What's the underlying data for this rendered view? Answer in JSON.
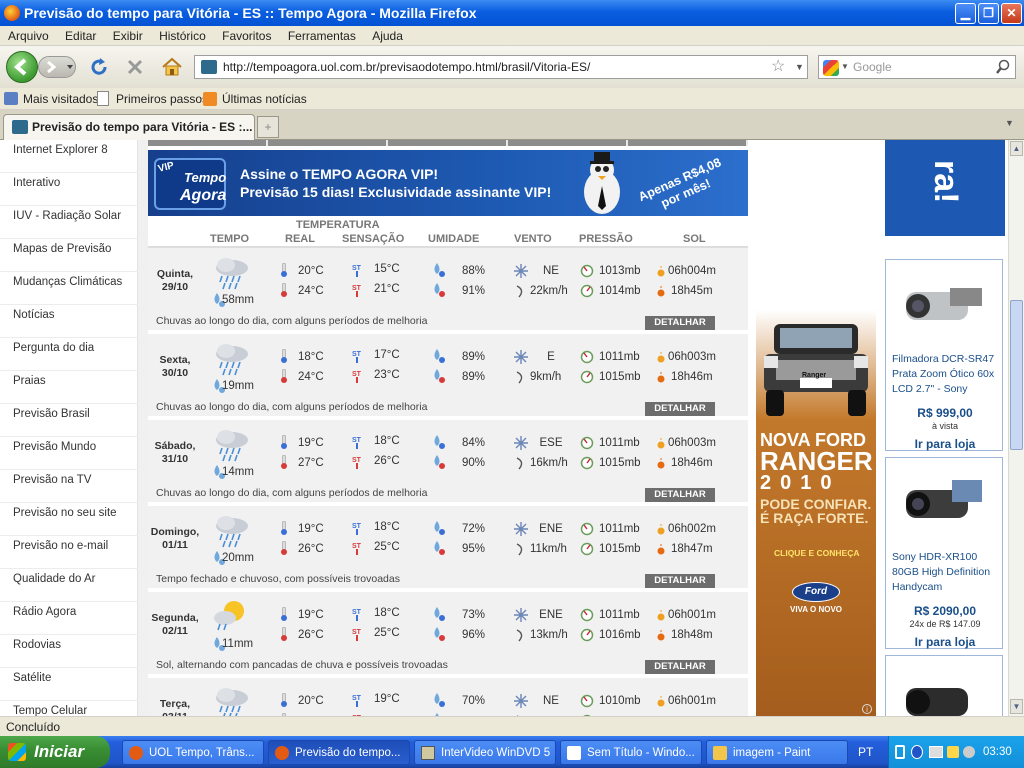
{
  "window": {
    "title": "Previsão do tempo para Vitória - ES :: Tempo Agora - Mozilla Firefox"
  },
  "menu": [
    "Arquivo",
    "Editar",
    "Exibir",
    "Histórico",
    "Favoritos",
    "Ferramentas",
    "Ajuda"
  ],
  "nav": {
    "url": "http://tempoagora.uol.com.br/previsaodotempo.html/brasil/Vitoria-ES/",
    "search_placeholder": "Google"
  },
  "bookmarks": [
    "Mais visitados",
    "Primeiros passos",
    "Últimas notícias"
  ],
  "tab": {
    "title": "Previsão do tempo para Vitória - ES :..."
  },
  "sidebar": [
    "Internet Explorer 8",
    "Interativo",
    "IUV - Radiação Solar",
    "Mapas de Previsão",
    "Mudanças Climáticas",
    "Notícias",
    "Pergunta do dia",
    "Praias",
    "Previsão Brasil",
    "Previsão Mundo",
    "Previsão na TV",
    "Previsão no seu site",
    "Previsão no e-mail",
    "Qualidade do Ar",
    "Rádio Agora",
    "Rodovias",
    "Satélite",
    "Tempo Celular"
  ],
  "banner": {
    "logo_top": "Tempo",
    "logo_bottom": "Agora",
    "vip": "VIP",
    "line1": "Assine o TEMPO AGORA VIP!",
    "line2": "Previsão 15 dias! Exclusividade assinante VIP!",
    "price1": "Apenas R$4,08",
    "price2": "por mês!"
  },
  "headers": {
    "group": "TEMPERATURA",
    "tempo": "TEMPO",
    "real": "REAL",
    "sensacao": "SENSAÇÃO",
    "umidade": "UMIDADE",
    "vento": "VENTO",
    "pressao": "PRESSÃO",
    "sol": "SOL"
  },
  "forecast": [
    {
      "day": "Quinta,",
      "date": "29/10",
      "rain": "58mm",
      "real_min": "20°C",
      "real_max": "24°C",
      "sens_min": "15°C",
      "sens_max": "21°C",
      "hum_min": "88%",
      "hum_max": "91%",
      "wind_dir": "NE",
      "wind_speed": "22km/h",
      "press_min": "1013mb",
      "press_max": "1014mb",
      "sunrise": "06h004m",
      "sunset": "18h45m",
      "desc": "Chuvas ao longo do dia, com alguns períodos de melhoria",
      "button": "DETALHAR"
    },
    {
      "day": "Sexta,",
      "date": "30/10",
      "rain": "19mm",
      "real_min": "18°C",
      "real_max": "24°C",
      "sens_min": "17°C",
      "sens_max": "23°C",
      "hum_min": "89%",
      "hum_max": "89%",
      "wind_dir": "E",
      "wind_speed": "9km/h",
      "press_min": "1011mb",
      "press_max": "1015mb",
      "sunrise": "06h003m",
      "sunset": "18h46m",
      "desc": "Chuvas ao longo do dia, com alguns períodos de melhoria",
      "button": "DETALHAR"
    },
    {
      "day": "Sábado,",
      "date": "31/10",
      "rain": "14mm",
      "real_min": "19°C",
      "real_max": "27°C",
      "sens_min": "18°C",
      "sens_max": "26°C",
      "hum_min": "84%",
      "hum_max": "90%",
      "wind_dir": "ESE",
      "wind_speed": "16km/h",
      "press_min": "1011mb",
      "press_max": "1015mb",
      "sunrise": "06h003m",
      "sunset": "18h46m",
      "desc": "Chuvas ao longo do dia, com alguns períodos de melhoria",
      "button": "DETALHAR"
    },
    {
      "day": "Domingo,",
      "date": "01/11",
      "rain": "20mm",
      "real_min": "19°C",
      "real_max": "26°C",
      "sens_min": "18°C",
      "sens_max": "25°C",
      "hum_min": "72%",
      "hum_max": "95%",
      "wind_dir": "ENE",
      "wind_speed": "11km/h",
      "press_min": "1011mb",
      "press_max": "1015mb",
      "sunrise": "06h002m",
      "sunset": "18h47m",
      "desc": "Tempo fechado e chuvoso, com possíveis trovoadas",
      "button": "DETALHAR"
    },
    {
      "day": "Segunda,",
      "date": "02/11",
      "rain": "11mm",
      "real_min": "19°C",
      "real_max": "26°C",
      "sens_min": "18°C",
      "sens_max": "25°C",
      "hum_min": "73%",
      "hum_max": "96%",
      "wind_dir": "ENE",
      "wind_speed": "13km/h",
      "press_min": "1011mb",
      "press_max": "1016mb",
      "sunrise": "06h001m",
      "sunset": "18h48m",
      "desc": "Sol, alternando com pancadas de chuva e possíveis trovoadas",
      "button": "DETALHAR"
    },
    {
      "day": "Terça,",
      "date": "03/11",
      "rain": "",
      "real_min": "20°C",
      "real_max": "",
      "sens_min": "19°C",
      "sens_max": "",
      "hum_min": "70%",
      "hum_max": "",
      "wind_dir": "NE",
      "wind_speed": "",
      "press_min": "1010mb",
      "press_max": "",
      "sunrise": "06h001m",
      "sunset": "",
      "desc": "",
      "button": ""
    }
  ],
  "ford_ad": {
    "badge": "Ranger",
    "title1": "NOVA FORD",
    "title2": "RANGER",
    "year": "2010",
    "slogan1": "PODE CONFIAR.",
    "slogan2": "É RAÇA FORTE.",
    "cta": "CLIQUE E CONHEÇA",
    "logo": "Ford",
    "tagline": "VIVA O NOVO"
  },
  "side_ads": {
    "top_text": "ra!",
    "items": [
      {
        "name": "Filmadora DCR-SR47 Prata Zoom Ótico 60x LCD 2.7\" - Sony",
        "price": "R$ 999,00",
        "terms": "à vista",
        "link": "Ir para loja"
      },
      {
        "name": "Sony HDR-XR100 80GB High Definition Handycam",
        "price": "R$ 2090,00",
        "terms": "24x de R$ 147.09",
        "link": "Ir para loja"
      }
    ]
  },
  "status": "Concluído",
  "taskbar": {
    "start": "Iniciar",
    "tasks": [
      "UOL Tempo, Trâns...",
      "Previsão do tempo...",
      "InterVideo WinDVD 5",
      "Sem Título - Windo...",
      "imagem - Paint"
    ],
    "lang": "PT",
    "clock": "03:30"
  },
  "colors": {
    "titlebar": "#0a5ee0",
    "banner": "#1e5bb4",
    "row_bg": "#f1f1f1",
    "button": "#6d6d6d",
    "ford": "#c3792b",
    "price": "#1a4f8a"
  }
}
